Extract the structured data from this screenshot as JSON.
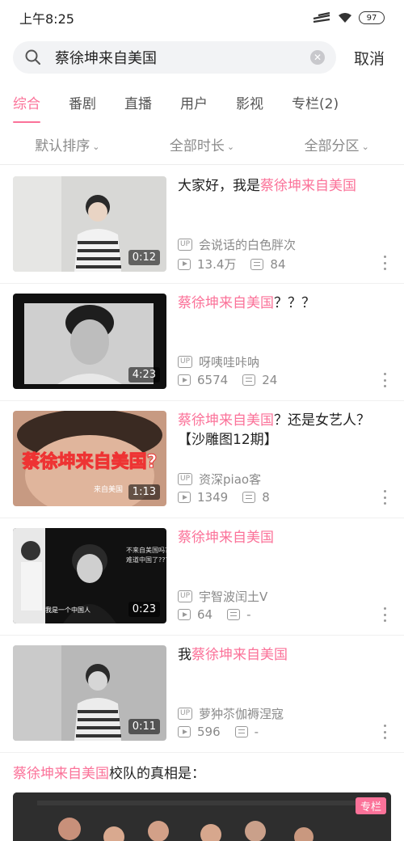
{
  "status_bar": {
    "time": "上午8:25",
    "battery": "97"
  },
  "search": {
    "query": "蔡徐坤来自美国",
    "cancel_label": "取消"
  },
  "tabs": [
    {
      "label": "综合",
      "active": true
    },
    {
      "label": "番剧",
      "active": false
    },
    {
      "label": "直播",
      "active": false
    },
    {
      "label": "用户",
      "active": false
    },
    {
      "label": "影视",
      "active": false
    },
    {
      "label": "专栏(2)",
      "active": false
    }
  ],
  "filters": [
    {
      "label": "默认排序"
    },
    {
      "label": "全部时长"
    },
    {
      "label": "全部分区"
    }
  ],
  "videos": [
    {
      "title_pre": "大家好，我是",
      "title_hl": "蔡徐坤来自美国",
      "title_post": "",
      "uploader": "会说话的白色胖次",
      "views": "13.4万",
      "danmaku": "84",
      "duration": "0:12"
    },
    {
      "title_pre": "",
      "title_hl": "蔡徐坤来自美国",
      "title_post": "？？？",
      "uploader": "呀咦哇咔呐",
      "views": "6574",
      "danmaku": "24",
      "duration": "4:23"
    },
    {
      "title_pre": "",
      "title_hl": "蔡徐坤来自美国",
      "title_post": "？还是女艺人？【沙雕图12期】",
      "uploader": "资深piao客",
      "views": "1349",
      "danmaku": "8",
      "duration": "1:13"
    },
    {
      "title_pre": "",
      "title_hl": "蔡徐坤来自美国",
      "title_post": "",
      "uploader": "宇智波闰土V",
      "views": "64",
      "danmaku": "-",
      "duration": "0:23"
    },
    {
      "title_pre": "我",
      "title_hl": "蔡徐坤来自美国",
      "title_post": "",
      "uploader": "萝狆苶伽褥涅寇",
      "views": "596",
      "danmaku": "-",
      "duration": "0:11"
    }
  ],
  "thumbnail_overlays": {
    "thumb3_caption": "蔡徐坤来自美国?",
    "thumb3_sub": "来自美国",
    "thumb4_question": "不来自美国吗？",
    "thumb4_question2": "难道中国了???",
    "thumb4_caption": "我是一个中国人"
  },
  "column": {
    "title_hl": "蔡徐坤来自美国",
    "title_post": "校队的真相是：",
    "badge": "专栏"
  },
  "colors": {
    "accent": "#fb7299",
    "text": "#212121",
    "muted": "#8a8a8a"
  }
}
